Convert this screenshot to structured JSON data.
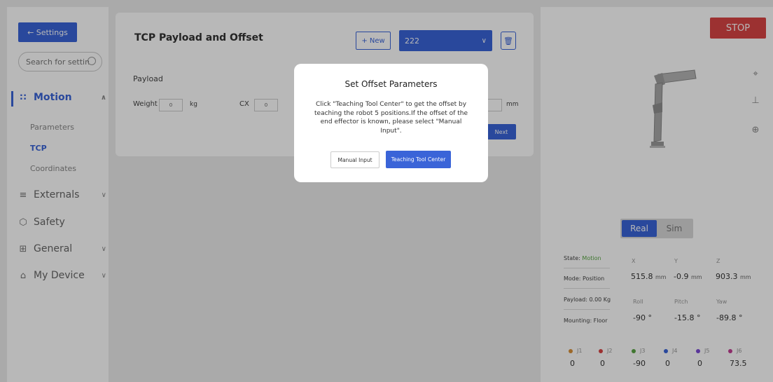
{
  "sidebar": {
    "back_label": "← Settings",
    "search_placeholder": "Search for settings",
    "items": [
      {
        "label": "Motion",
        "icon": "motion-icon",
        "active": true
      },
      {
        "label": "Externals",
        "icon": "externals-icon"
      },
      {
        "label": "Safety",
        "icon": "safety-icon"
      },
      {
        "label": "General",
        "icon": "general-icon"
      },
      {
        "label": "My Device",
        "icon": "my-device-icon"
      }
    ],
    "motion_subitems": [
      "Parameters",
      "TCP",
      "Coordinates"
    ]
  },
  "main": {
    "title": "TCP Payload and Offset",
    "new_label": "+ New",
    "selected_tcp": "222",
    "payload_label": "Payload",
    "weight_label": "Weight",
    "weight_value": "0",
    "weight_unit": "kg",
    "cx_label": "CX",
    "cx_value": "0",
    "offset_unit": "mm",
    "next_label": "Next"
  },
  "modal": {
    "title": "Set Offset Parameters",
    "body": "Click \"Teaching Tool Center\" to get the offset by teaching the robot 5 positions.If the offset of the end effector is known, please select \"Manual Input\".",
    "manual_label": "Manual Input",
    "teach_label": "Teaching Tool Center"
  },
  "right": {
    "stop_label": "STOP",
    "mode_real": "Real",
    "mode_sim": "Sim",
    "state_label": "State:",
    "state_value": "Motion",
    "mode_label": "Mode: Position",
    "payload_label": "Payload: 0.00 Kg",
    "mounting_label": "Mounting: Floor",
    "coords": {
      "x_h": "X",
      "y_h": "Y",
      "z_h": "Z",
      "x": "515.8",
      "y": "-0.9",
      "z": "903.3",
      "unit": "mm",
      "roll_h": "Roll",
      "pitch_h": "Pitch",
      "yaw_h": "Yaw",
      "roll": "-90 °",
      "pitch": "-15.8 °",
      "yaw": "-89.8 °"
    },
    "joints": [
      {
        "name": "J1",
        "value": "0",
        "color": "#d9913a"
      },
      {
        "name": "J2",
        "value": "0",
        "color": "#d94545"
      },
      {
        "name": "J3",
        "value": "-90",
        "color": "#5aa645"
      },
      {
        "name": "J4",
        "value": "0",
        "color": "#3a64d8"
      },
      {
        "name": "J5",
        "value": "0",
        "color": "#7c4bd6"
      },
      {
        "name": "J6",
        "value": "73.5",
        "color": "#c23f93"
      }
    ]
  },
  "colors": {
    "accent": "#3a64d8",
    "stop": "#d94545",
    "state_ok": "#5aa645"
  }
}
